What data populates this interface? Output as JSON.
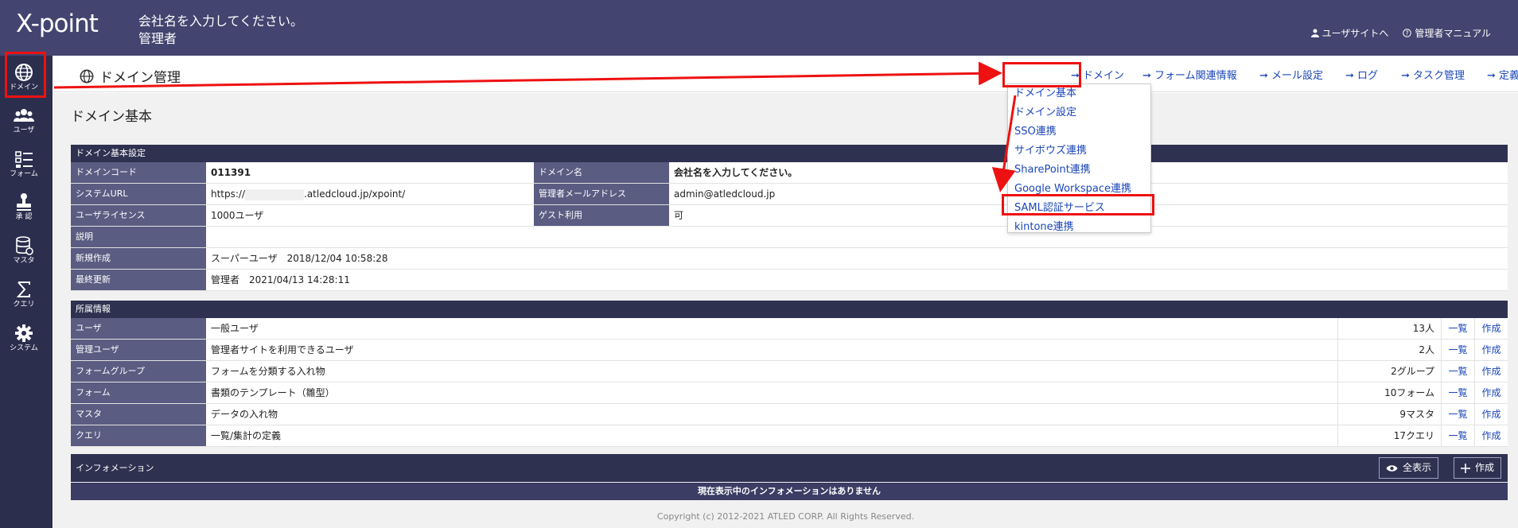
{
  "header": {
    "logo": "X-point",
    "company_name": "会社名を入力してください。",
    "role": "管理者",
    "user_site_link": "ユーザサイトへ",
    "manual_link": "管理者マニュアル"
  },
  "sidebar": {
    "items": [
      {
        "label": "ドメイン",
        "icon": "globe-icon"
      },
      {
        "label": "ユーザ",
        "icon": "users-icon"
      },
      {
        "label": "フォーム",
        "icon": "form-list-icon"
      },
      {
        "label": "承 認",
        "icon": "stamp-icon"
      },
      {
        "label": "マスタ",
        "icon": "database-icon"
      },
      {
        "label": "クエリ",
        "icon": "sigma-icon"
      },
      {
        "label": "システム",
        "icon": "gear-icon"
      }
    ]
  },
  "page": {
    "title": "ドメイン管理",
    "section_heading": "ドメイン基本"
  },
  "nav": {
    "items": [
      "ドメイン",
      "フォーム関連情報",
      "メール設定",
      "ログ",
      "タスク管理",
      "定義書出力"
    ]
  },
  "dropdown": {
    "items": [
      "ドメイン基本",
      "ドメイン設定",
      "SSO連携",
      "サイボウズ連携",
      "SharePoint連携",
      "Google Workspace連携",
      "SAML認証サービス",
      "kintone連携"
    ]
  },
  "basic_settings": {
    "heading": "ドメイン基本設定",
    "domain_code_label": "ドメインコード",
    "domain_code": "011391",
    "domain_name_label": "ドメイン名",
    "domain_name": "会社名を入力してください。",
    "system_url_label": "システムURL",
    "system_url_prefix": "https://",
    "system_url_suffix": ".atledcloud.jp/xpoint/",
    "admin_email_label": "管理者メールアドレス",
    "admin_email": "admin@atledcloud.jp",
    "user_license_label": "ユーザライセンス",
    "user_license": "1000ユーザ",
    "guest_label": "ゲスト利用",
    "guest": "可",
    "description_label": "説明",
    "description": "",
    "created_label": "新規作成",
    "created": "スーパーユーザ　2018/12/04 10:58:28",
    "updated_label": "最終更新",
    "updated": "管理者　2021/04/13 14:28:11"
  },
  "affiliation": {
    "heading": "所属情報",
    "list_label": "一覧",
    "create_label": "作成",
    "rows": [
      {
        "label": "ユーザ",
        "desc": "一般ユーザ",
        "count": "13人"
      },
      {
        "label": "管理ユーザ",
        "desc": "管理者サイトを利用できるユーザ",
        "count": "2人"
      },
      {
        "label": "フォームグループ",
        "desc": "フォームを分類する入れ物",
        "count": "2グループ"
      },
      {
        "label": "フォーム",
        "desc": "書類のテンプレート（雛型）",
        "count": "10フォーム"
      },
      {
        "label": "マスタ",
        "desc": "データの入れ物",
        "count": "9マスタ"
      },
      {
        "label": "クエリ",
        "desc": "一覧/集計の定義",
        "count": "17クエリ"
      }
    ]
  },
  "information": {
    "heading": "インフォメーション",
    "show_all": "全表示",
    "create": "作成",
    "empty_message": "現在表示中のインフォメーションはありません"
  },
  "footer": {
    "copyright": "Copyright (c) 2012-2021 ATLED CORP. All Rights Reserved."
  },
  "colors": {
    "header_bg": "#43446f",
    "sidebar_bg": "#2c2e4e",
    "table_head": "#2f3151",
    "label_bg": "#5a5c82",
    "link": "#1b46b8",
    "annotation": "#ee1111"
  }
}
